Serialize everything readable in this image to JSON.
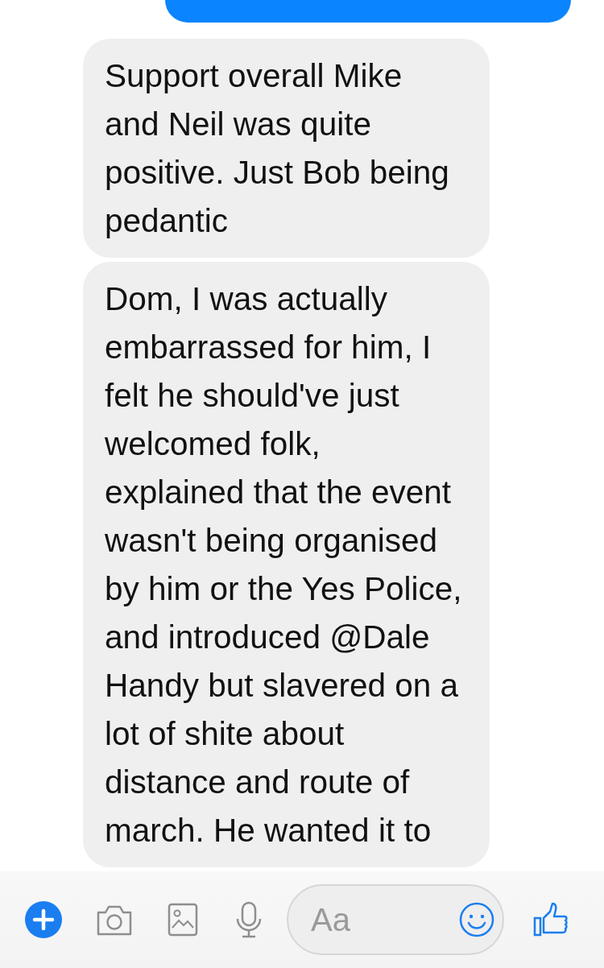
{
  "messages": [
    {
      "kind": "sent"
    },
    {
      "kind": "received",
      "text": "Support overall Mike and Neil was quite positive. Just Bob being pedantic"
    },
    {
      "kind": "received",
      "text": "Dom, I was actually embarrassed for him, I felt he should've just welcomed folk, explained that the event wasn't being organised by him or the Yes Police, and introduced @Dale Handy but slavered on a lot of shite about distance and route of march. He wanted it to"
    }
  ],
  "composer": {
    "placeholder": "Aa"
  }
}
